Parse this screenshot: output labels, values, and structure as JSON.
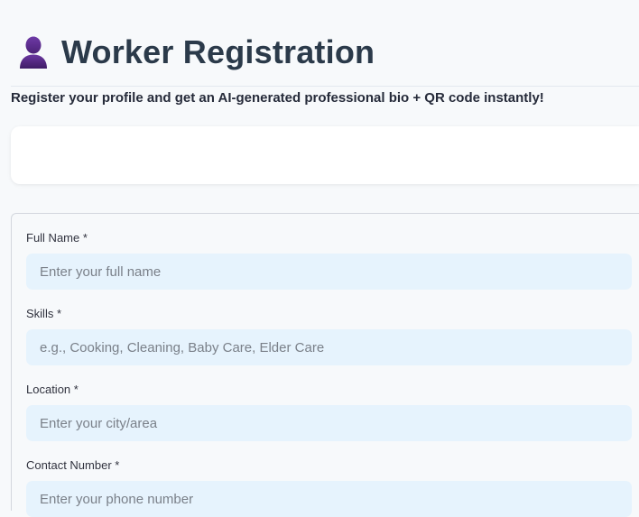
{
  "header": {
    "icon": "person-silhouette-icon",
    "title": "Worker Registration"
  },
  "subtitle": "Register your profile and get an AI-generated professional bio + QR code instantly!",
  "colors": {
    "background": "#f7f9fb",
    "input_background": "#e6f3fd",
    "title": "#2b3a4a",
    "icon": "#5a2c8a"
  },
  "form": {
    "fields": [
      {
        "label": "Full Name *",
        "placeholder": "Enter your full name",
        "value": ""
      },
      {
        "label": "Skills *",
        "placeholder": "e.g., Cooking, Cleaning, Baby Care, Elder Care",
        "value": ""
      },
      {
        "label": "Location *",
        "placeholder": "Enter your city/area",
        "value": ""
      },
      {
        "label": "Contact Number *",
        "placeholder": "Enter your phone number",
        "value": ""
      }
    ]
  }
}
